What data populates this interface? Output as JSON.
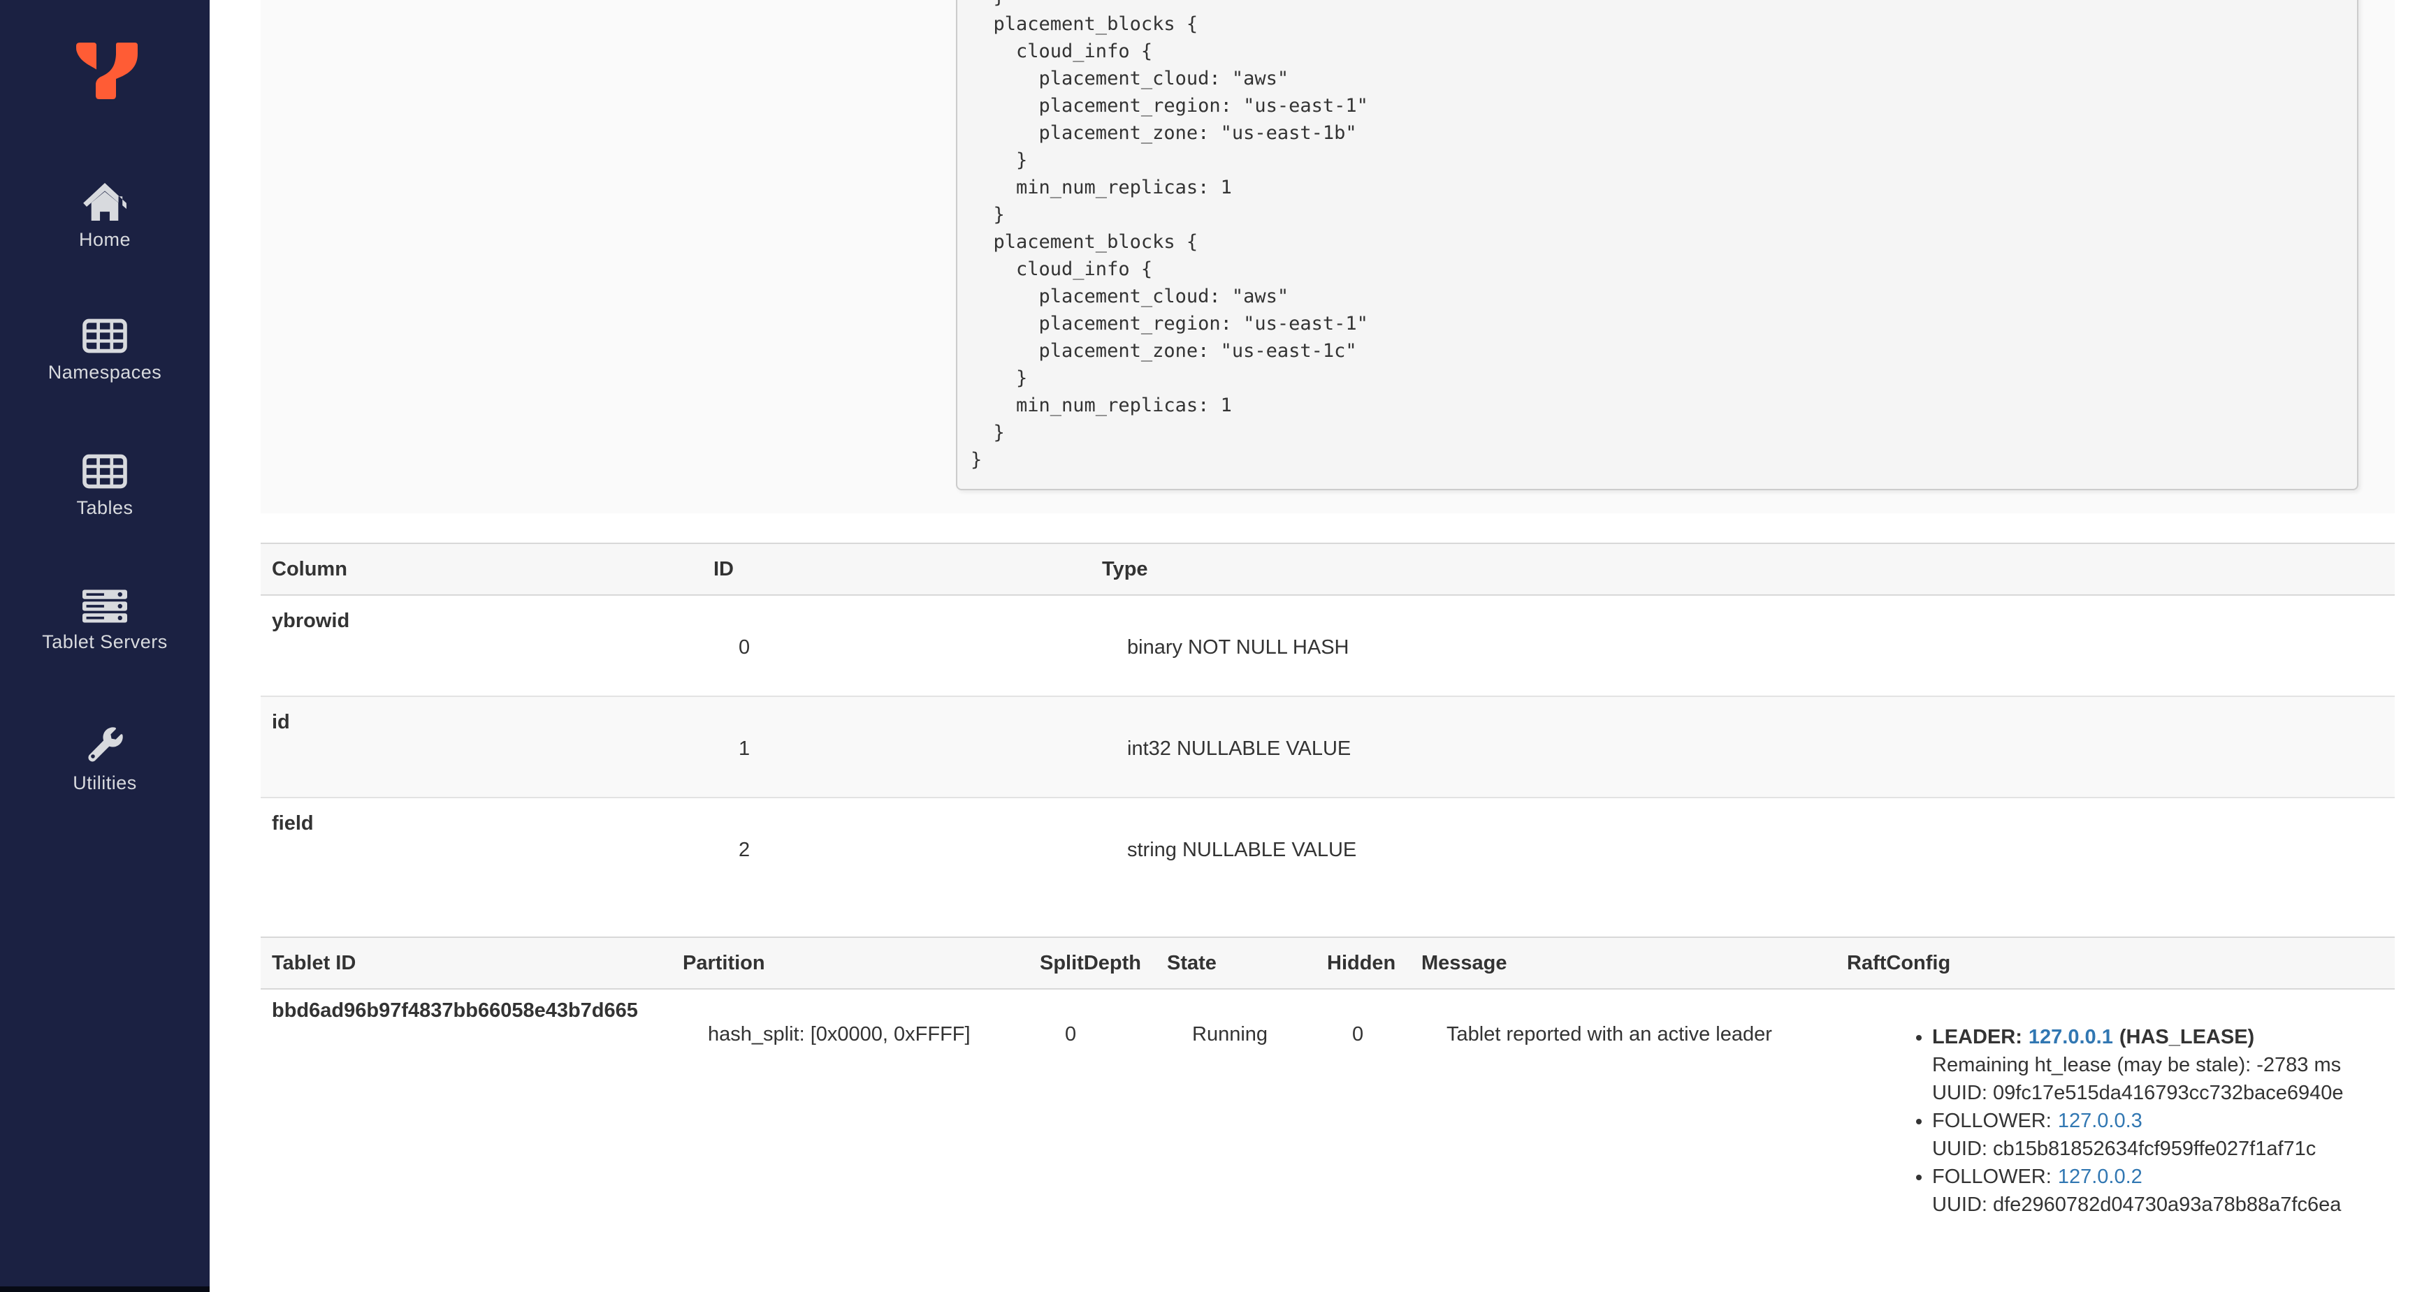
{
  "colors": {
    "accent": "#ff5c35",
    "sidebar_bg": "#1b2142",
    "link_blue": "#3177b2"
  },
  "sidebar": {
    "items": [
      {
        "icon": "home-icon",
        "label": "Home"
      },
      {
        "icon": "grid-icon",
        "label": "Namespaces"
      },
      {
        "icon": "grid-icon",
        "label": "Tables"
      },
      {
        "icon": "servers-icon",
        "label": "Tablet Servers"
      },
      {
        "icon": "wrench-icon",
        "label": "Utilities"
      }
    ]
  },
  "replication_info": {
    "code": "  }\n  placement_blocks {\n    cloud_info {\n      placement_cloud: \"aws\"\n      placement_region: \"us-east-1\"\n      placement_zone: \"us-east-1b\"\n    }\n    min_num_replicas: 1\n  }\n  placement_blocks {\n    cloud_info {\n      placement_cloud: \"aws\"\n      placement_region: \"us-east-1\"\n      placement_zone: \"us-east-1c\"\n    }\n    min_num_replicas: 1\n  }\n}"
  },
  "columns_table": {
    "headers": [
      "Column",
      "ID",
      "Type"
    ],
    "rows": [
      {
        "name": "ybrowid",
        "id": "0",
        "type": "binary NOT NULL HASH"
      },
      {
        "name": "id",
        "id": "1",
        "type": "int32 NULLABLE VALUE"
      },
      {
        "name": "field",
        "id": "2",
        "type": "string NULLABLE VALUE"
      }
    ]
  },
  "tablets_table": {
    "headers": [
      "Tablet ID",
      "Partition",
      "SplitDepth",
      "State",
      "Hidden",
      "Message",
      "RaftConfig"
    ],
    "rows": [
      {
        "tablet_id": "bbd6ad96b97f4837bb66058e43b7d665",
        "partition": "hash_split: [0x0000, 0xFFFF]",
        "split_depth": "0",
        "state": "Running",
        "hidden": "0",
        "message": "Tablet reported with an active leader",
        "raft": [
          {
            "role": "LEADER:",
            "host": "127.0.0.1",
            "note": "(HAS_LEASE)",
            "lines": [
              "Remaining ht_lease (may be stale): -2783 ms",
              "UUID: 09fc17e515da416793cc732bace6940e"
            ]
          },
          {
            "role": "FOLLOWER:",
            "host": "127.0.0.3",
            "lines": [
              "UUID: cb15b81852634fcf959ffe027f1af71c"
            ]
          },
          {
            "role": "FOLLOWER:",
            "host": "127.0.0.2",
            "lines": [
              "UUID: dfe2960782d04730a93a78b88a7fc6ea"
            ]
          }
        ]
      }
    ]
  }
}
